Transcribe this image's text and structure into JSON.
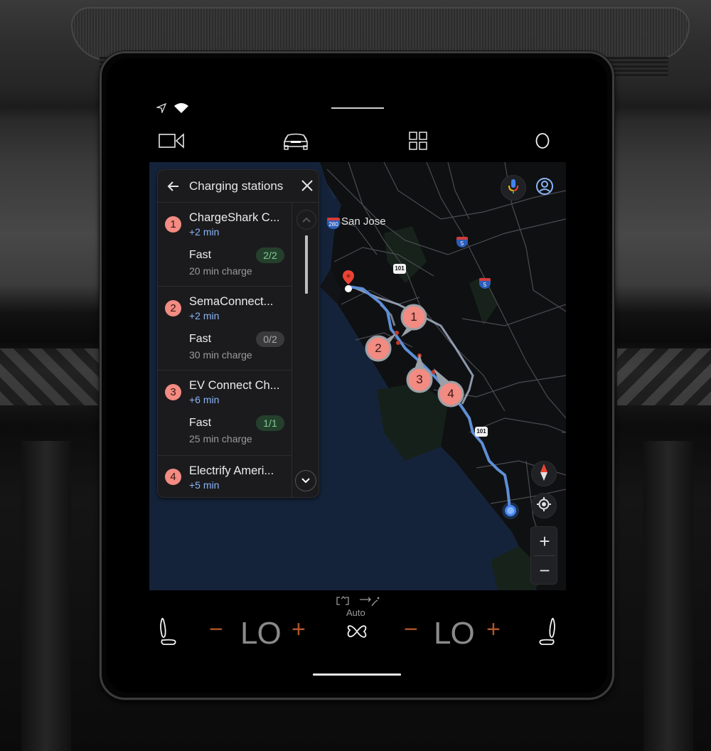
{
  "status_bar": {
    "icons": [
      "navigation-arrow-icon",
      "wifi-icon"
    ]
  },
  "top_nav": {
    "items": [
      {
        "name": "camera",
        "icon": "video-camera-icon"
      },
      {
        "name": "car",
        "icon": "car-icon"
      },
      {
        "name": "apps",
        "icon": "app-grid-icon"
      },
      {
        "name": "assistant",
        "icon": "circle-icon"
      }
    ]
  },
  "panel": {
    "title": "Charging stations",
    "back_icon": "arrow-left-icon",
    "close_icon": "close-icon",
    "stations": [
      {
        "index": "1",
        "name": "ChargeShark C...",
        "detour": "+2 min",
        "speed": "Fast",
        "availability": "2/2",
        "availability_status": "available",
        "charge_time": "20 min charge"
      },
      {
        "index": "2",
        "name": "SemaConnect...",
        "detour": "+2 min",
        "speed": "Fast",
        "availability": "0/2",
        "availability_status": "unavailable",
        "charge_time": "30 min charge"
      },
      {
        "index": "3",
        "name": "EV Connect Ch...",
        "detour": "+6 min",
        "speed": "Fast",
        "availability": "1/1",
        "availability_status": "available",
        "charge_time": "25 min charge"
      },
      {
        "index": "4",
        "name": "Electrify Ameri...",
        "detour": "+5 min"
      }
    ],
    "scroll_up_icon": "chevron-up-icon",
    "scroll_down_icon": "chevron-down-icon"
  },
  "map": {
    "city_label": "San Jose",
    "highway_shields": [
      {
        "label": "280",
        "type": "interstate"
      },
      {
        "label": "5",
        "type": "interstate"
      },
      {
        "label": "5",
        "type": "interstate"
      },
      {
        "label": "101",
        "type": "us-route"
      },
      {
        "label": "101",
        "type": "us-route"
      }
    ],
    "station_pins": [
      "1",
      "2",
      "3",
      "4"
    ],
    "controls": {
      "mic_icon": "microphone-icon",
      "account_icon": "account-icon",
      "compass_icon": "compass-icon",
      "recenter_icon": "my-location-icon",
      "zoom_in": "+",
      "zoom_out": "−"
    }
  },
  "climate": {
    "left_seat_icon": "seat-heat-left-icon",
    "right_seat_icon": "seat-heat-right-icon",
    "driver_temp": "LO",
    "passenger_temp": "LO",
    "minus": "−",
    "plus": "+",
    "fan_mode": "Auto",
    "fan_icon": "fan-icon",
    "recirculate_icon": "recirculate-icon",
    "airflow_icon": "airflow-icon"
  },
  "colors": {
    "route": "#5e8fd6",
    "pin": "#f28b82",
    "available": "#81c995",
    "detour": "#8ab4f8",
    "temp_adjust": "#b0552a",
    "destination": "#ea4335"
  }
}
